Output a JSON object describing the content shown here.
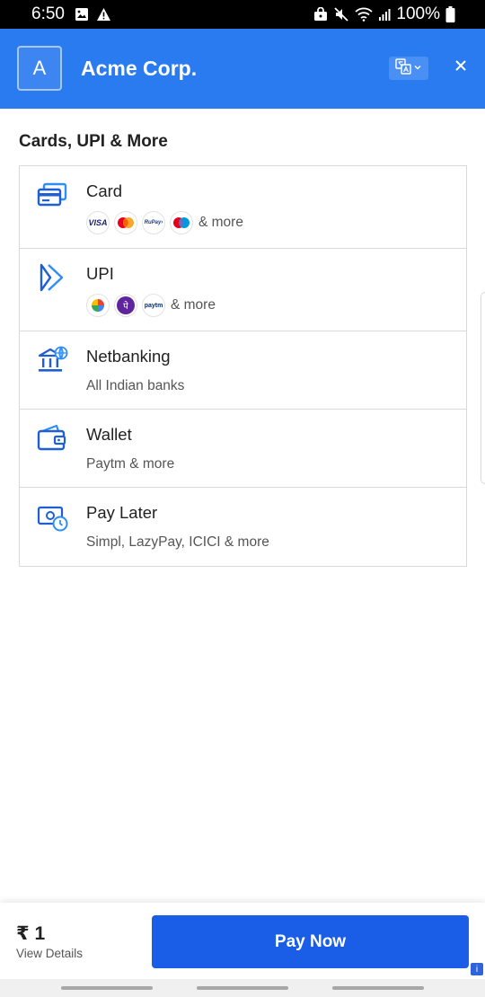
{
  "status_bar": {
    "time": "6:50",
    "battery": "100%"
  },
  "header": {
    "logo_letter": "A",
    "merchant_name": "Acme Corp."
  },
  "section": {
    "title": "Cards, UPI & More"
  },
  "methods": [
    {
      "id": "card",
      "label": "Card",
      "badges": [
        "visa",
        "mastercard",
        "rupay",
        "maestro"
      ],
      "more": "& more"
    },
    {
      "id": "upi",
      "label": "UPI",
      "badges": [
        "google-pay",
        "phonepe",
        "paytm"
      ],
      "more": "& more"
    },
    {
      "id": "netbanking",
      "label": "Netbanking",
      "subtitle": "All Indian banks"
    },
    {
      "id": "wallet",
      "label": "Wallet",
      "subtitle": "Paytm & more"
    },
    {
      "id": "paylater",
      "label": "Pay Later",
      "subtitle": "Simpl, LazyPay, ICICI & more"
    }
  ],
  "badge_text": {
    "visa": "VISA",
    "rupay": "RuPay›",
    "phonepe": "पे",
    "paytm": "paytm"
  },
  "footer": {
    "amount": "₹ 1",
    "view_details": "View Details",
    "pay_button": "Pay Now"
  },
  "colors": {
    "header_bg": "#2b7bf0",
    "primary_button": "#1a5ee8",
    "icon_blue": "#1f5fd1",
    "icon_light_blue": "#2d8ef5"
  }
}
